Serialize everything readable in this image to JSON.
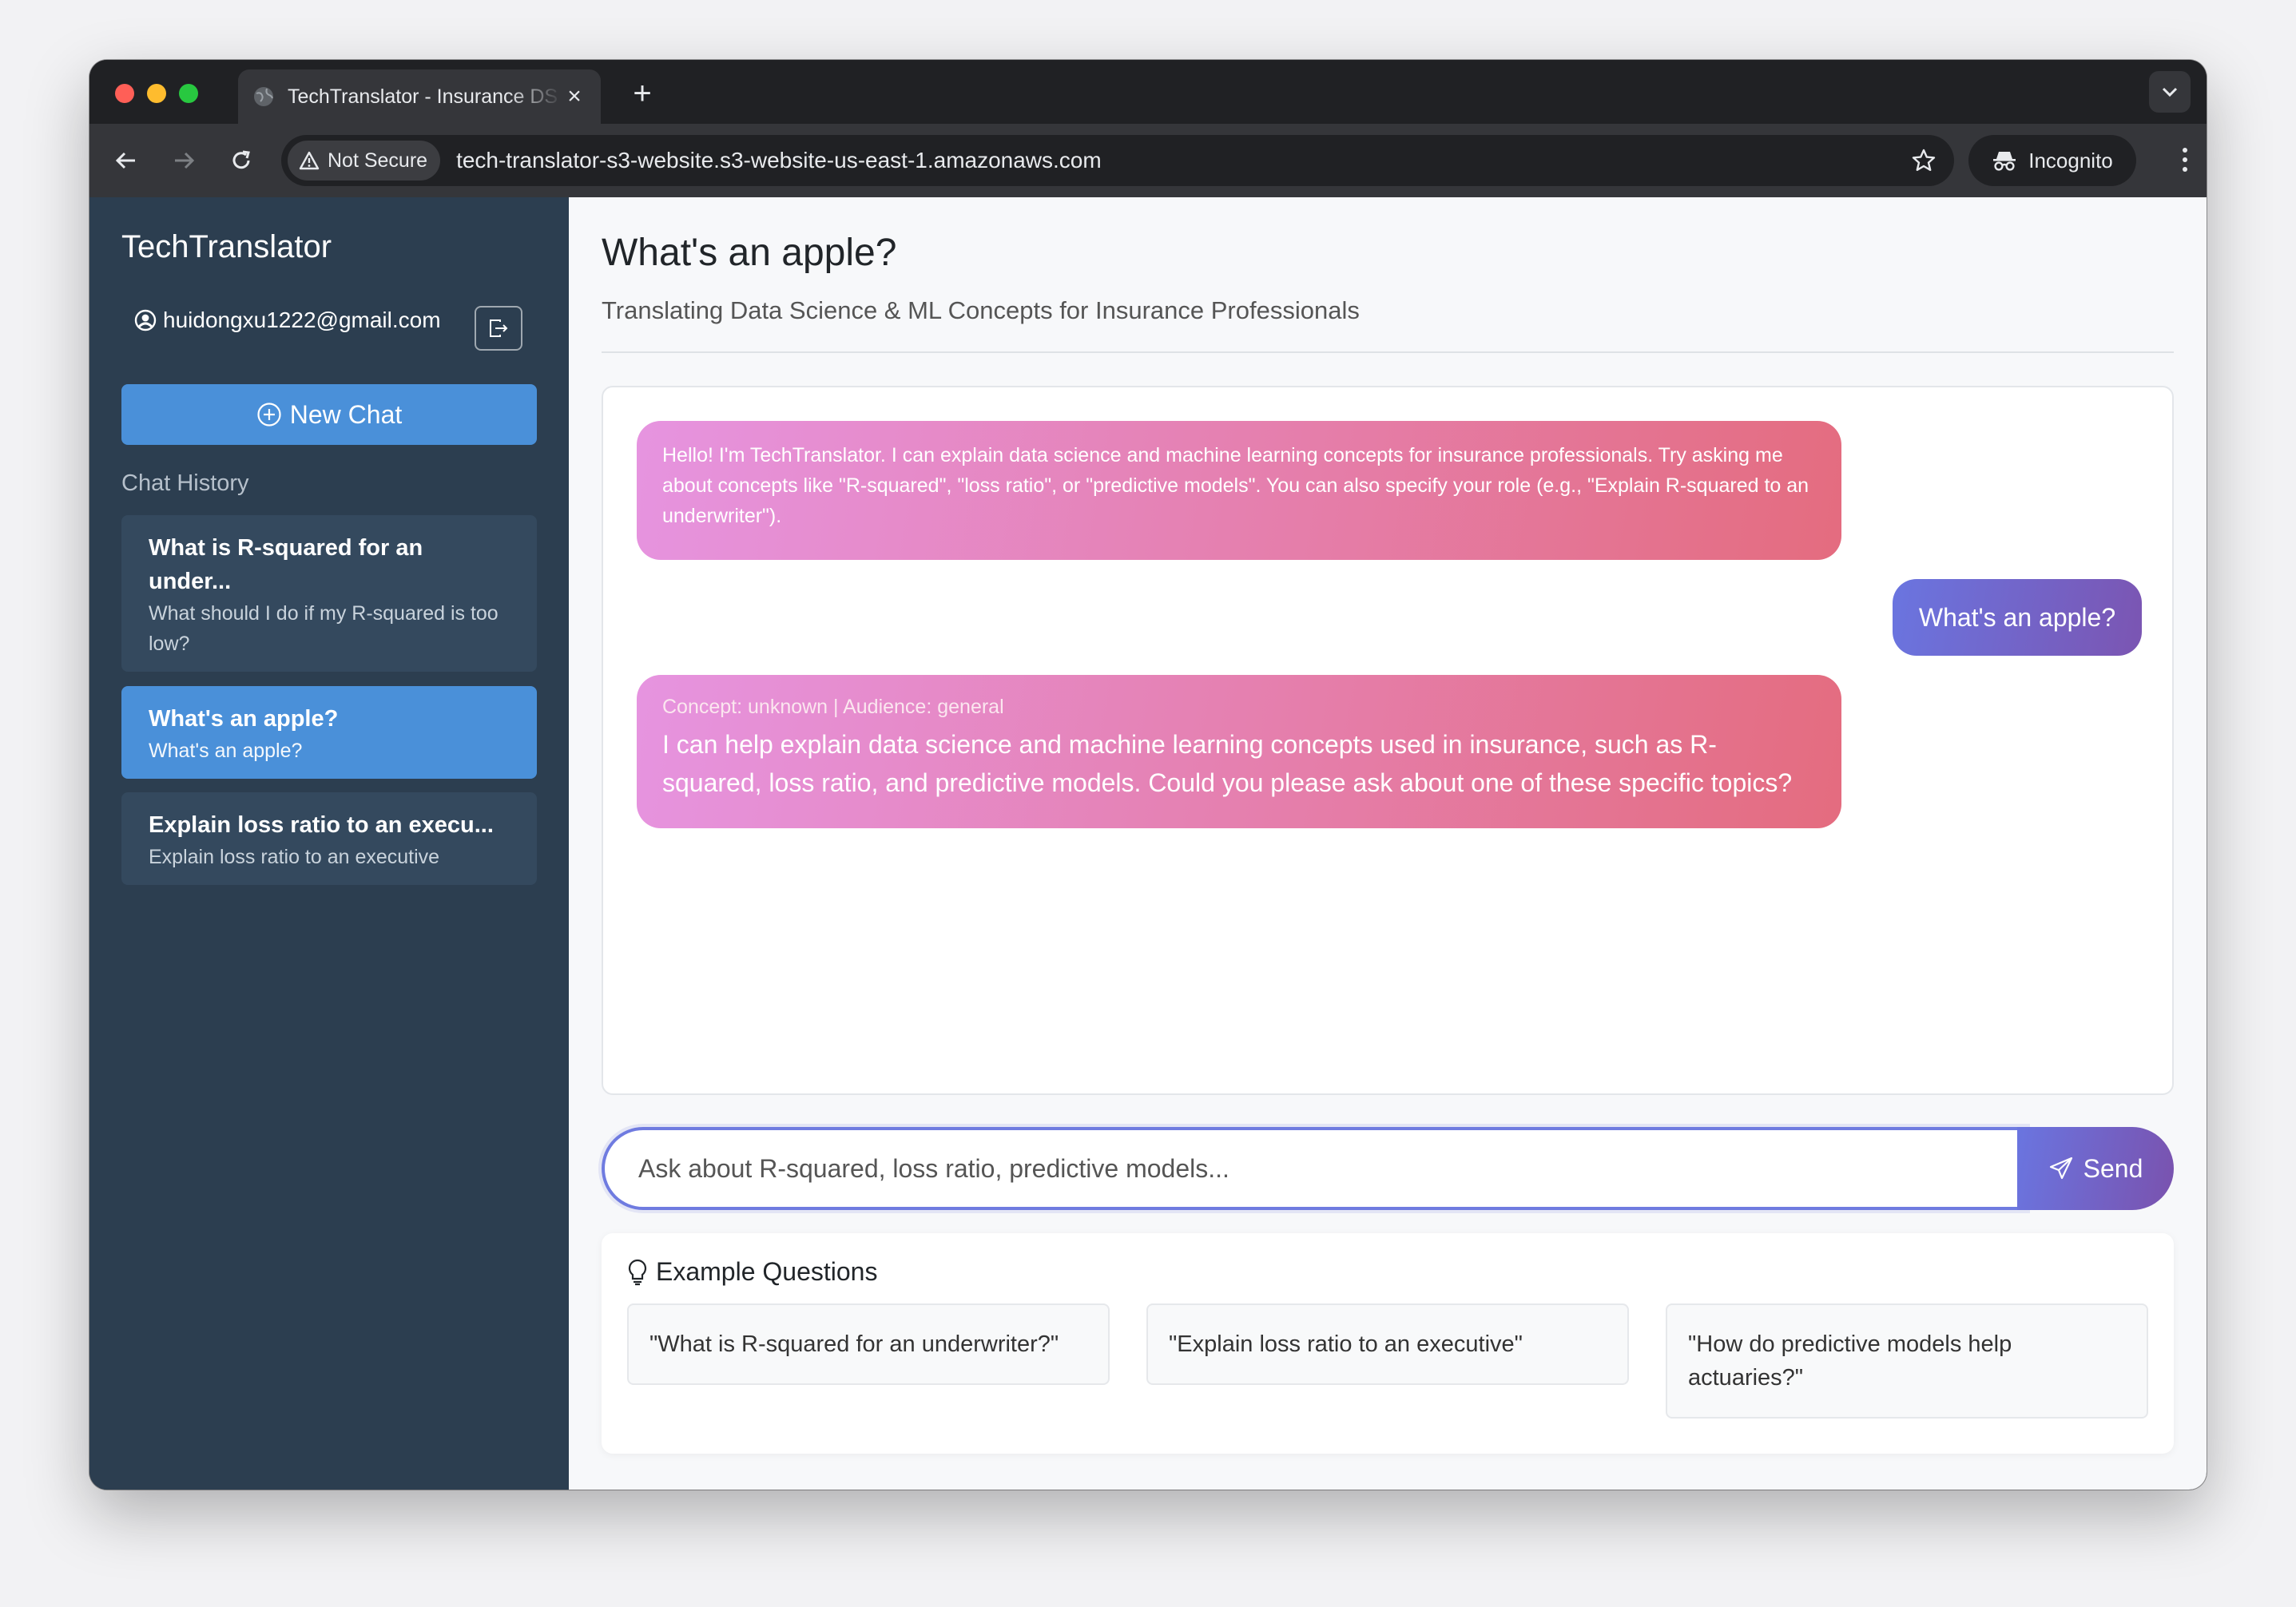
{
  "browser": {
    "tab_title": "TechTranslator - Insurance DS",
    "security_label": "Not Secure",
    "url": "tech-translator-s3-website.s3-website-us-east-1.amazonaws.com",
    "profile_label": "Incognito",
    "traffic_light_colors": [
      "#ff5f57",
      "#febc2e",
      "#28c840"
    ]
  },
  "sidebar": {
    "brand": "TechTranslator",
    "user_email": "huidongxu1222@gmail.com",
    "new_chat_label": "New Chat",
    "history_label": "Chat History",
    "history": [
      {
        "title": "What is R-squared for an under...",
        "subtitle": "What should I do if my R-squared is too low?",
        "active": false
      },
      {
        "title": "What's an apple?",
        "subtitle": "What's an apple?",
        "active": true
      },
      {
        "title": "Explain loss ratio to an execu...",
        "subtitle": "Explain loss ratio to an executive",
        "active": false
      }
    ]
  },
  "main": {
    "title": "What's an apple?",
    "subtitle": "Translating Data Science & ML Concepts for Insurance Professionals",
    "messages": [
      {
        "role": "bot",
        "text": "Hello! I'm TechTranslator. I can explain data science and machine learning concepts for insurance professionals. Try asking me about concepts like \"R-squared\", \"loss ratio\", or \"predictive models\". You can also specify your role (e.g., \"Explain R-squared to an underwriter\")."
      },
      {
        "role": "user",
        "text": "What's an apple?"
      },
      {
        "role": "bot",
        "meta": "Concept: unknown | Audience: general",
        "text": "I can help explain data science and machine learning concepts used in insurance, such as R-squared, loss ratio, and predictive models. Could you please ask about one of these specific topics?"
      }
    ],
    "input_placeholder": "Ask about R-squared, loss ratio, predictive models...",
    "send_label": "Send",
    "examples_title": "Example Questions",
    "examples": [
      "\"What is R-squared for an underwriter?\"",
      "\"Explain loss ratio to an executive\"",
      "\"How do predictive models help actuaries?\""
    ]
  },
  "colors": {
    "sidebar_bg": "#2c3e50",
    "accent_blue": "#4a90d9",
    "bot_gradient": [
      "#e694e0",
      "#e46c7f"
    ],
    "user_gradient": [
      "#6a75e0",
      "#7b55b2"
    ]
  }
}
